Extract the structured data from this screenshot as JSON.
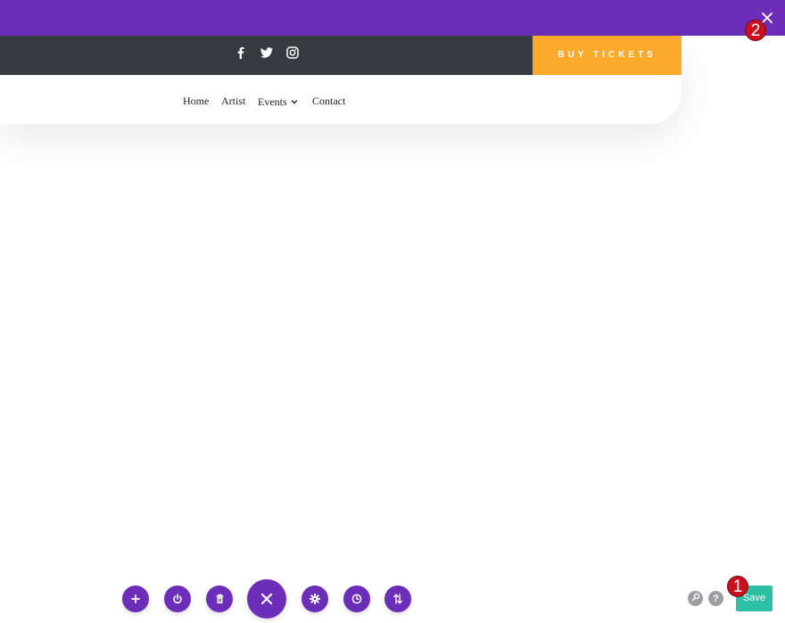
{
  "topbar": {
    "close_icon": "close-icon",
    "color": "#6c2eb9"
  },
  "badges": {
    "first": "1",
    "second": "2"
  },
  "header": {
    "social": [
      {
        "icon": "facebook-icon"
      },
      {
        "icon": "twitter-icon"
      },
      {
        "icon": "instagram-icon"
      }
    ],
    "buy_tickets_label": "BUY TICKETS",
    "buy_tickets_color": "#fbaa2b",
    "social_bar_color": "#393a40",
    "nav": {
      "home": "Home",
      "artist": "Artist",
      "events": "Events",
      "contact": "Contact"
    }
  },
  "toolbar": {
    "buttons": [
      "plus-icon",
      "power-icon",
      "trash-icon",
      "close-icon",
      "gear-icon",
      "history-icon",
      "sort-icon"
    ],
    "accent": "#6c2eb9"
  },
  "footer_right": {
    "help_label": "?",
    "save_label": "Save",
    "save_color": "#2cc0a4"
  }
}
